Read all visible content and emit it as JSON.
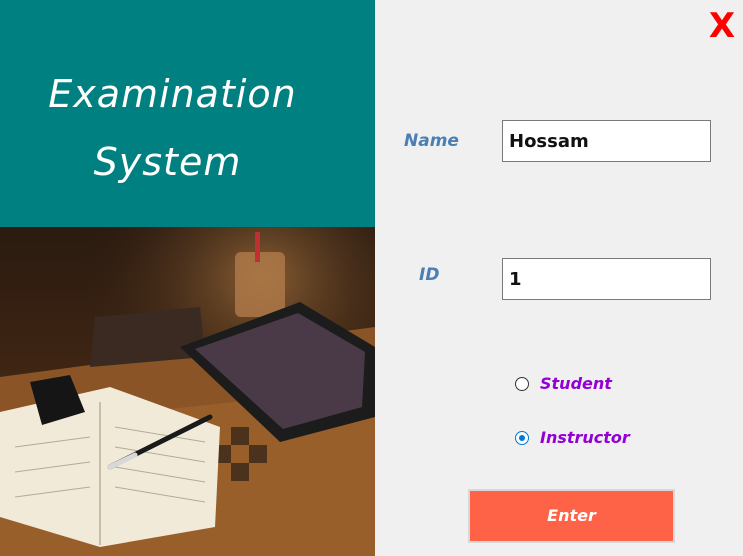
{
  "window": {
    "close_label": "X"
  },
  "branding": {
    "title_line1": "Examination",
    "title_line2": "System",
    "panel_color": "#008080"
  },
  "form": {
    "name_label": "Name",
    "name_value": "Hossam",
    "id_label": "ID",
    "id_value": "1",
    "roles": [
      {
        "label": "Student",
        "selected": false
      },
      {
        "label": "Instructor",
        "selected": true
      }
    ],
    "enter_label": "Enter"
  },
  "colors": {
    "close": "#ff0000",
    "label": "#4a7fb4",
    "radio_label": "#9400d3",
    "enter_button": "#ff6347",
    "background": "#f0f0f0"
  },
  "icons": {
    "photo": "desk-with-tablet-notebook-pen-photo"
  }
}
